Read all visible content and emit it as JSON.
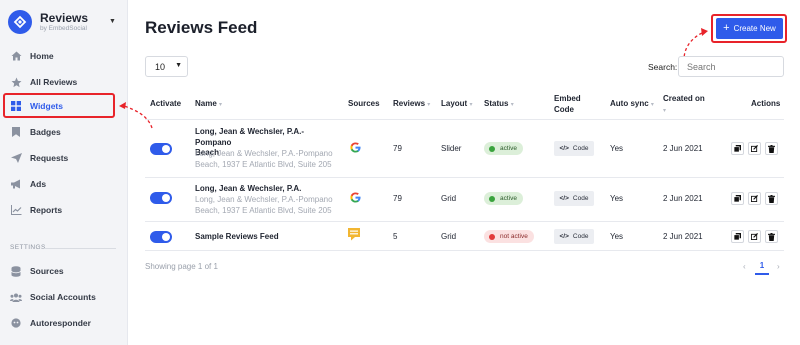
{
  "brand": {
    "name": "Reviews",
    "subtitle": "by EmbedSocial"
  },
  "sidebar": {
    "items": [
      {
        "label": "Home",
        "icon": "home-icon"
      },
      {
        "label": "All Reviews",
        "icon": "star-icon"
      },
      {
        "label": "Widgets",
        "icon": "widgets-icon",
        "active": true
      },
      {
        "label": "Badges",
        "icon": "bookmark-icon"
      },
      {
        "label": "Requests",
        "icon": "send-icon"
      },
      {
        "label": "Ads",
        "icon": "megaphone-icon"
      },
      {
        "label": "Reports",
        "icon": "chart-icon"
      }
    ],
    "settings_label": "SETTINGS",
    "settings_items": [
      {
        "label": "Sources",
        "icon": "database-icon"
      },
      {
        "label": "Social Accounts",
        "icon": "users-icon"
      },
      {
        "label": "Autoresponder",
        "icon": "robot-icon"
      }
    ]
  },
  "main": {
    "title": "Reviews Feed",
    "create_label": "Create New",
    "per_page": "10",
    "search_label": "Search:",
    "search_placeholder": "Search",
    "columns": {
      "activate": "Activate",
      "name": "Name",
      "sources": "Sources",
      "reviews": "Reviews",
      "layout": "Layout",
      "status": "Status",
      "embed_line1": "Embed",
      "embed_line2": "Code",
      "autosync": "Auto sync",
      "created_line1": "Created on",
      "actions": "Actions"
    },
    "rows": [
      {
        "name_line1": "Long, Jean & Wechsler, P.A.-Pompano",
        "name_line2": "Beach",
        "sub_line1": "Long, Jean & Wechsler, P.A.-Pompano",
        "sub_line2": "Beach, 1937 E Atlantic Blvd, Suite 205",
        "source": "google-icon",
        "reviews": "79",
        "layout": "Slider",
        "status": "active",
        "code": "Code",
        "autosync": "Yes",
        "created": "2 Jun 2021"
      },
      {
        "name_line1": "Long, Jean & Wechsler, P.A.",
        "sub_line1": "Long, Jean & Wechsler, P.A.-Pompano",
        "sub_line2": "Beach, 1937 E Atlantic Blvd, Suite 205",
        "source": "google-icon",
        "reviews": "79",
        "layout": "Grid",
        "status": "active",
        "code": "Code",
        "autosync": "Yes",
        "created": "2 Jun 2021"
      },
      {
        "name_line1": "Sample Reviews Feed",
        "source": "chat-icon",
        "reviews": "5",
        "layout": "Grid",
        "status": "not active",
        "code": "Code",
        "autosync": "Yes",
        "created": "2 Jun 2021"
      }
    ],
    "footer_text": "Showing page 1 of 1",
    "pager": {
      "prev": "‹",
      "current": "1",
      "next": "›"
    }
  },
  "colors": {
    "accent": "#2f5bea",
    "highlight": "#e8232a",
    "active": "#3aa33d",
    "inactive": "#e23b3b"
  }
}
